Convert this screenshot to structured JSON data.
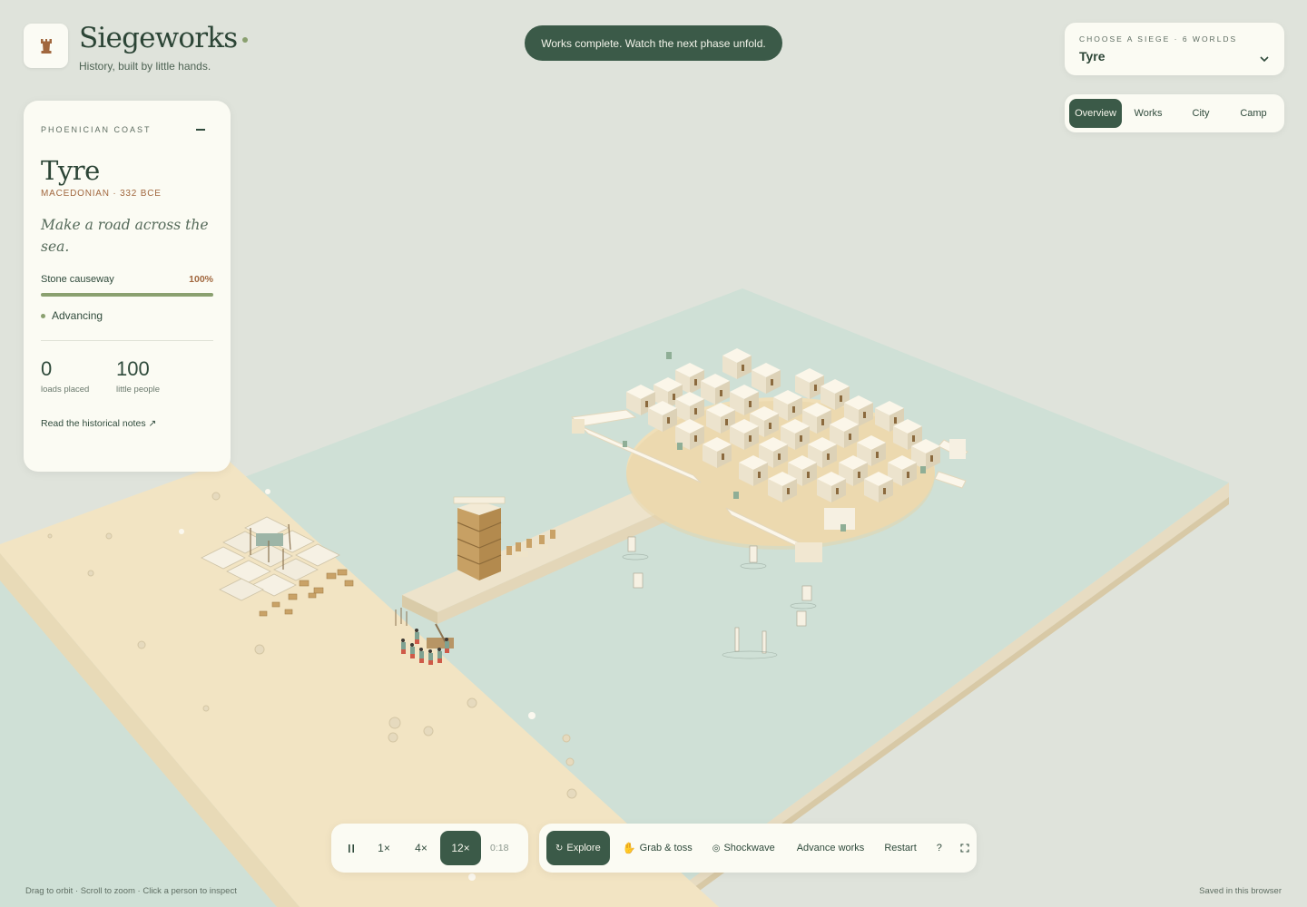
{
  "brand": {
    "title": "Siegeworks",
    "tagline": "History, built by little hands.",
    "logo_icon": "rook-tower-icon"
  },
  "toast": {
    "message": "Works complete. Watch the next phase unfold."
  },
  "info": {
    "region": "PHOENICIAN COAST",
    "name": "Tyre",
    "subtitle": "MACEDONIAN · 332 BCE",
    "quote": "Make a road across the sea.",
    "progress": {
      "label": "Stone causeway",
      "value_label": "100%",
      "value": 100
    },
    "status": "Advancing",
    "stats": [
      {
        "value": "0",
        "label": "loads placed"
      },
      {
        "value": "100",
        "label": "little people"
      }
    ],
    "notes_link": "Read the historical notes ↗"
  },
  "selector": {
    "label": "CHOOSE A SIEGE · 6 WORLDS",
    "value": "Tyre",
    "options": [
      "Tyre"
    ]
  },
  "views": {
    "tabs": [
      {
        "label": "Overview",
        "active": true
      },
      {
        "label": "Works",
        "active": false
      },
      {
        "label": "City",
        "active": false
      },
      {
        "label": "Camp",
        "active": false
      }
    ]
  },
  "speed": {
    "pause_label": "II",
    "speeds": [
      {
        "label": "1×",
        "active": false
      },
      {
        "label": "4×",
        "active": false
      },
      {
        "label": "12×",
        "active": true
      }
    ],
    "time": "0:18"
  },
  "actions": {
    "explore": "Explore",
    "grab": "Grab & toss",
    "shockwave": "Shockwave",
    "advance": "Advance works",
    "restart": "Restart",
    "help": "?"
  },
  "hints": {
    "left": "Drag to orbit · Scroll to zoom · Click a person to inspect",
    "right": "Saved in this browser"
  },
  "colors": {
    "accent": "#3b5a48",
    "progress": "#8aa06f",
    "era": "#a1673e",
    "sea": "#cfe0d6",
    "sand": "#f2e4c3",
    "background": "#dfe3db"
  }
}
